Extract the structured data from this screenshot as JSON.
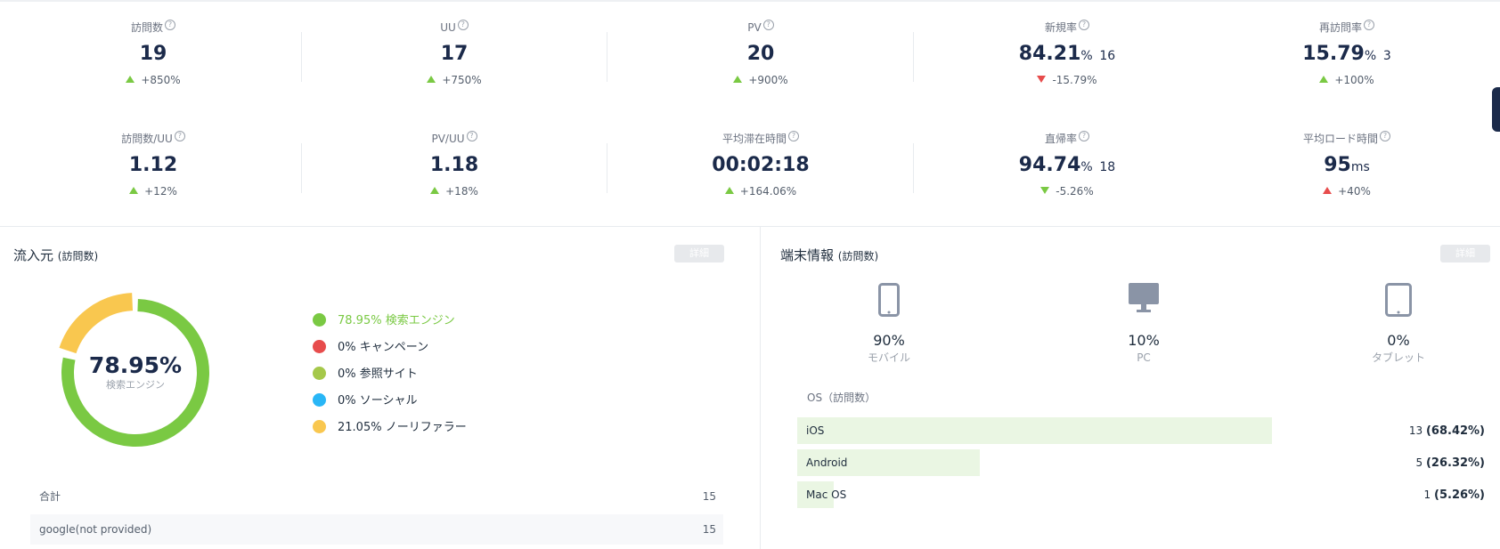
{
  "metrics": [
    {
      "label": "訪問数",
      "value": "19",
      "unit": "",
      "sub": "",
      "change": "+850%",
      "trend": "up",
      "color": "green"
    },
    {
      "label": "UU",
      "value": "17",
      "unit": "",
      "sub": "",
      "change": "+750%",
      "trend": "up",
      "color": "green"
    },
    {
      "label": "PV",
      "value": "20",
      "unit": "",
      "sub": "",
      "change": "+900%",
      "trend": "up",
      "color": "green"
    },
    {
      "label": "新規率",
      "value": "84.21",
      "unit": "%",
      "sub": "16",
      "change": "-15.79%",
      "trend": "down",
      "color": "red"
    },
    {
      "label": "再訪問率",
      "value": "15.79",
      "unit": "%",
      "sub": "3",
      "change": "+100%",
      "trend": "up",
      "color": "green"
    },
    {
      "label": "訪問数/UU",
      "value": "1.12",
      "unit": "",
      "sub": "",
      "change": "+12%",
      "trend": "up",
      "color": "green"
    },
    {
      "label": "PV/UU",
      "value": "1.18",
      "unit": "",
      "sub": "",
      "change": "+18%",
      "trend": "up",
      "color": "green"
    },
    {
      "label": "平均滞在時間",
      "value": "00:02:18",
      "unit": "",
      "sub": "",
      "change": "+164.06%",
      "trend": "up",
      "color": "green"
    },
    {
      "label": "直帰率",
      "value": "94.74",
      "unit": "%",
      "sub": "18",
      "change": "-5.26%",
      "trend": "down",
      "color": "green"
    },
    {
      "label": "平均ロード時間",
      "value": "95",
      "unit": "ms",
      "sub": "",
      "change": "+40%",
      "trend": "up",
      "color": "red"
    }
  ],
  "help_glyph": "?",
  "traffic": {
    "title": "流入元",
    "title_sub": "(訪問数)",
    "detail_label": "詳細",
    "center_pct": "78.95%",
    "center_label": "検索エンジン",
    "legend": [
      {
        "pct": "78.95%",
        "label": "検索エンジン",
        "color": "#7ac943",
        "highlight": true
      },
      {
        "pct": "0%",
        "label": "キャンペーン",
        "color": "#e74c4c",
        "highlight": false
      },
      {
        "pct": "0%",
        "label": "参照サイト",
        "color": "#a5c84a",
        "highlight": false
      },
      {
        "pct": "0%",
        "label": "ソーシャル",
        "color": "#29b6f6",
        "highlight": false
      },
      {
        "pct": "21.05%",
        "label": "ノーリファラー",
        "color": "#f9c74f",
        "highlight": false
      }
    ],
    "donut_fractions": [
      0.7895,
      0.2105
    ],
    "rows": [
      {
        "name": "合計",
        "value": "15"
      },
      {
        "name": "google(not provided)",
        "value": "15"
      }
    ]
  },
  "device": {
    "title": "端末情報",
    "title_sub": "(訪問数)",
    "detail_label": "詳細",
    "types": [
      {
        "icon": "smartphone-icon",
        "pct": "90%",
        "label": "モバイル"
      },
      {
        "icon": "desktop-icon",
        "pct": "10%",
        "label": "PC"
      },
      {
        "icon": "tablet-icon",
        "pct": "0%",
        "label": "タブレット"
      }
    ],
    "os_title": "OS（訪問数）",
    "os": [
      {
        "name": "iOS",
        "count": "13",
        "pct": "(68.42%)",
        "fraction": 0.6842
      },
      {
        "name": "Android",
        "count": "5",
        "pct": "(26.32%)",
        "fraction": 0.2632
      },
      {
        "name": "Mac OS",
        "count": "1",
        "pct": "(5.26%)",
        "fraction": 0.0526
      }
    ]
  },
  "colors": {
    "accent_green": "#7ac943",
    "alert_red": "#e74c4c",
    "navy": "#1b2a4a"
  }
}
